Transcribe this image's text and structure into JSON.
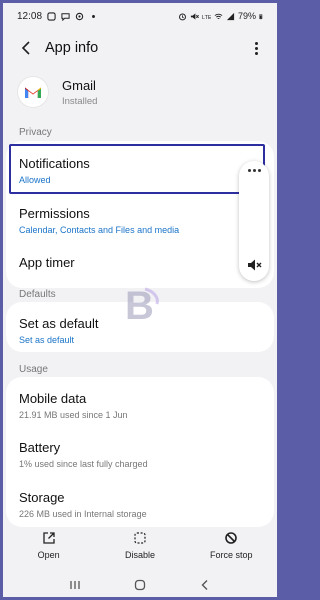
{
  "status_bar": {
    "time": "12:08",
    "battery": "79%",
    "left_icons": [
      "app-icon",
      "message-icon",
      "circle-icon",
      "dot-icon"
    ],
    "right_icons": [
      "alarm-icon",
      "mute-icon",
      "volte-icon",
      "wifi-icon",
      "signal-icon",
      "battery-icon"
    ]
  },
  "header": {
    "title": "App info"
  },
  "app": {
    "name": "Gmail",
    "status": "Installed"
  },
  "sections": {
    "privacy": "Privacy",
    "defaults": "Defaults",
    "usage": "Usage"
  },
  "privacy_items": [
    {
      "title": "Notifications",
      "subtitle": "Allowed"
    },
    {
      "title": "Permissions",
      "subtitle": "Calendar, Contacts and Files and media"
    },
    {
      "title": "App timer"
    }
  ],
  "defaults_item": {
    "title": "Set as default",
    "subtitle": "Set as default"
  },
  "usage_items": [
    {
      "title": "Mobile data",
      "subtitle": "21.91 MB used since 1 Jun"
    },
    {
      "title": "Battery",
      "subtitle": "1% used since last fully charged"
    },
    {
      "title": "Storage",
      "subtitle": "226 MB used in Internal storage"
    }
  ],
  "bottom_actions": [
    {
      "label": "Open",
      "icon": "open-external-icon"
    },
    {
      "label": "Disable",
      "icon": "disable-icon"
    },
    {
      "label": "Force stop",
      "icon": "force-stop-icon"
    }
  ],
  "watermark_letter": "B",
  "colors": {
    "accent_link": "#1b74c9",
    "highlight_border": "#2d2fa0",
    "frame": "#5b5ea6"
  }
}
